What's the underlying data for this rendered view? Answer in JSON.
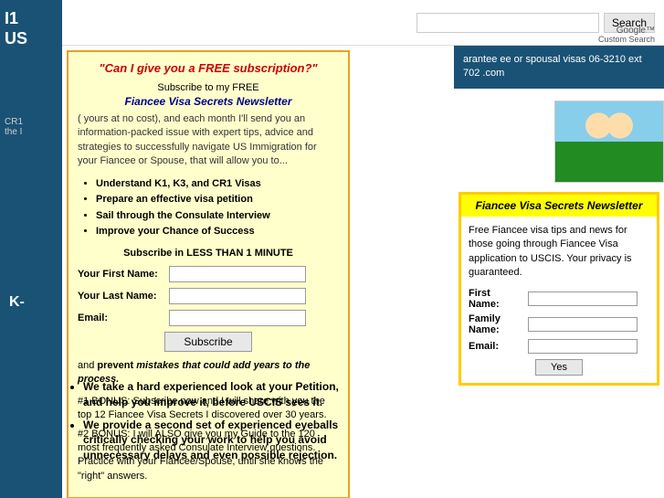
{
  "sidebar": {
    "top_text": "I1\nUS",
    "cr1_text": "CR1\nthe I",
    "k_text": "K-"
  },
  "header": {
    "search_placeholder": "",
    "search_button_label": "Search",
    "google_label": "Google™",
    "custom_search_label": "Custom Search"
  },
  "subscription_box": {
    "title": "\"Can I give you a FREE subscription?\"",
    "subscribe_to_my": "Subscribe to my FREE",
    "newsletter_name": "Fiancee Visa Secrets Newsletter",
    "description": "( yours at no cost), and each month I'll send you an information-packed issue with expert tips, advice and strategies to successfully navigate US Immigration for your Fiancee or Spouse, that will allow you to...",
    "benefits": [
      "Understand K1, K3, and CR1 Visas",
      "Prepare an effective visa petition",
      "Sail through the Consulate Interview",
      "Improve your Chance of Success"
    ],
    "tagline": "Subscribe in LESS THAN 1 MINUTE",
    "first_name_label": "Your First Name:",
    "last_name_label": "Your Last Name:",
    "email_label": "Email:",
    "subscribe_button": "Subscribe",
    "prevent_text": "and prevent mistakes that could add years to the process.",
    "bonus1": "#1 BONUS: Subscribe now and I will share with you the top 12 Fiancee Visa Secrets I discovered over 30 years.",
    "bonus2": "#2 BONUS: I will ALSO give you my Guide to the 120 most frequently asked Consulate Interview questions. Practice with your Fiancee/Spouse, until she knows the \"right\" answers."
  },
  "guarantee_box": {
    "text": "arantee\nee or spousal visas\n06-3210 ext 702\n.com"
  },
  "newsletter_box_right": {
    "header": "Fiancee Visa Secrets Newsletter",
    "description": "Free Fiancee visa tips and news for those going through Fiancee Visa application to USCIS. Your privacy is guaranteed.",
    "first_name_label": "First\nName:",
    "family_name_label": "Family\nName:",
    "email_label": "Email:",
    "yes_button": "Yes"
  },
  "bullets": [
    "We take a hard experienced look at your Petition, and help you improve it, before USCIS sees it.",
    "We provide a second set of experienced eyeballs critically checking your work to help you avoid unnecessary delays and even possible rejection."
  ]
}
